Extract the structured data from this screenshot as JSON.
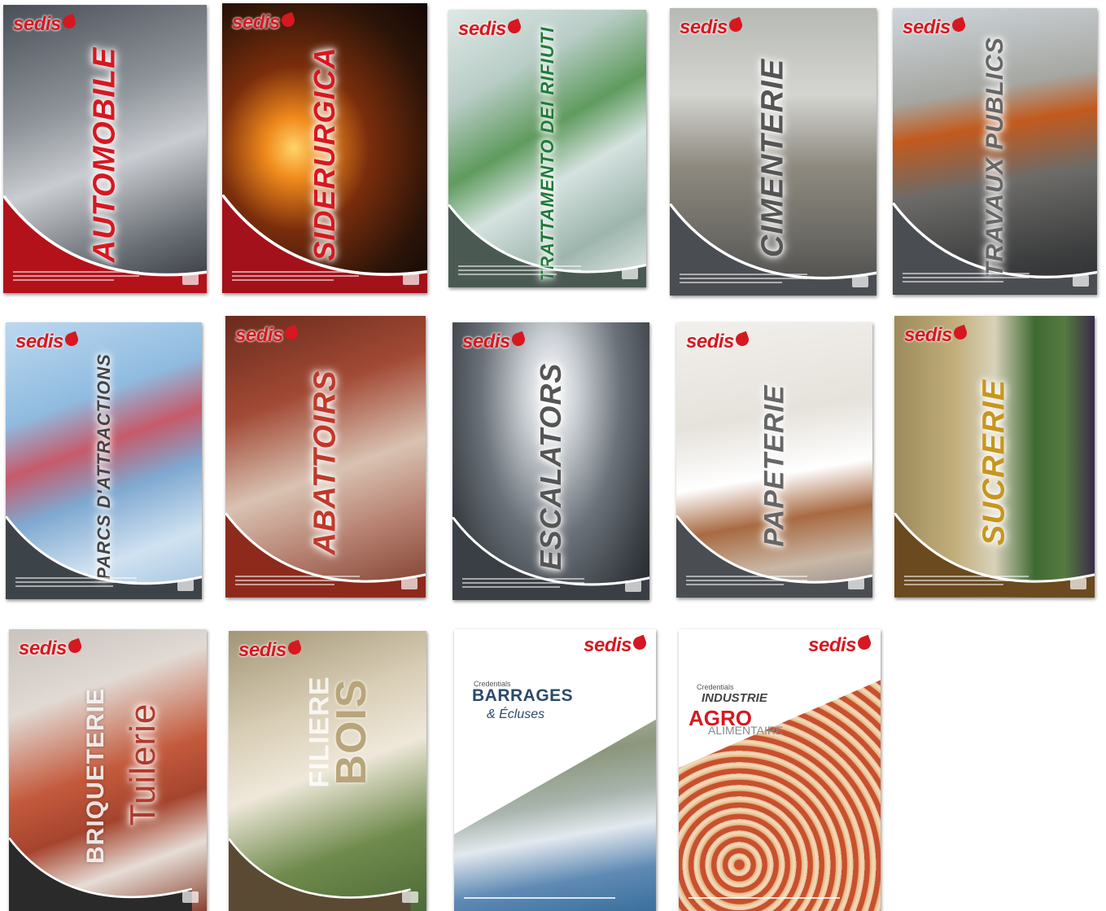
{
  "brand": {
    "logo_text": "sedis",
    "logo_color": "#d61820"
  },
  "covers": [
    {
      "title": "AUTOMOBILE",
      "title_color": "#d61820",
      "theme": "red"
    },
    {
      "title": "SIDERURGICA",
      "title_color": "#d61820",
      "theme": "red"
    },
    {
      "title": "TRATTAMENTO DEI RIFIUTI",
      "title_color": "#1f7a3a",
      "theme": "green"
    },
    {
      "title": "CIMENTERIE",
      "title_color": "#555555",
      "theme": "grey"
    },
    {
      "title": "TRAVAUX PUBLICS",
      "title_color": "#666666",
      "theme": "grey"
    },
    {
      "title": "PARCS D'ATTRACTIONS",
      "title_color": "#444444",
      "theme": "slate"
    },
    {
      "title": "ABATTOIRS",
      "title_color": "#c0392b",
      "theme": "rust"
    },
    {
      "title": "ESCALATORS",
      "title_color": "#555555",
      "theme": "grey"
    },
    {
      "title": "PAPETERIE",
      "title_color": "#666666",
      "theme": "grey"
    },
    {
      "title": "SUCRERIE",
      "title_color": "#c8961e",
      "theme": "brown"
    },
    {
      "title_line1": "BRIQUETERIE",
      "title_line2": "Tuilerie",
      "title_color": "#b03a2e",
      "theme": "brick"
    },
    {
      "title_line1": "FILIERE",
      "title_line2": "BOIS",
      "title_color": "#b9a57a",
      "theme": "wood"
    },
    {
      "kicker": "Credentials",
      "title_line1": "BARRAGES",
      "title_line2": "& Écluses",
      "title_color": "#2c4a6b",
      "theme": "dam"
    },
    {
      "kicker": "Credentials",
      "title_line1": "INDUSTRIE",
      "title_line2": "AGRO",
      "title_line3": "ALIMENTAIRE",
      "title_color": "#d61820",
      "theme": "agro"
    }
  ]
}
